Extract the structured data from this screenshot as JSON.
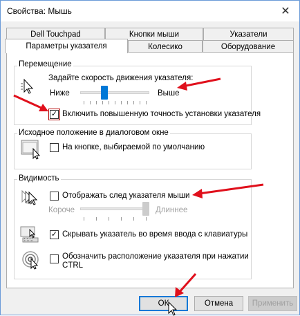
{
  "window": {
    "title": "Свойства: Мышь"
  },
  "tabs_row1": [
    "Dell Touchpad",
    "Кнопки мыши",
    "Указатели"
  ],
  "tabs_row2": [
    "Параметры указателя",
    "Колесико",
    "Оборудование"
  ],
  "motion": {
    "legend": "Перемещение",
    "speed_label": "Задайте скорость движения указателя:",
    "slow": "Ниже",
    "fast": "Выше",
    "speed_fraction": 0.33,
    "enhance_precision": {
      "label": "Включить повышенную точность установки указателя",
      "checked": true
    }
  },
  "snap": {
    "legend": "Исходное положение в диалоговом окне",
    "label": "На кнопке, выбираемой по умолчанию",
    "checked": false
  },
  "visibility": {
    "legend": "Видимость",
    "trails": {
      "label": "Отображать след указателя мыши",
      "checked": false
    },
    "trail_short": "Короче",
    "trail_long": "Длиннее",
    "trail_fraction": 1.0,
    "hide_typing": {
      "label": "Скрывать указатель во время ввода с клавиатуры",
      "checked": true
    },
    "show_location": {
      "label": "Обозначить расположение указателя при нажатии CTRL",
      "checked": false
    }
  },
  "buttons": {
    "ok": "ОК",
    "cancel": "Отмена",
    "apply": "Применить"
  },
  "colors": {
    "accent": "#0078d7",
    "annotation": "#e0101c"
  },
  "check_mark": "✓",
  "icons": {
    "close": "close-icon"
  }
}
